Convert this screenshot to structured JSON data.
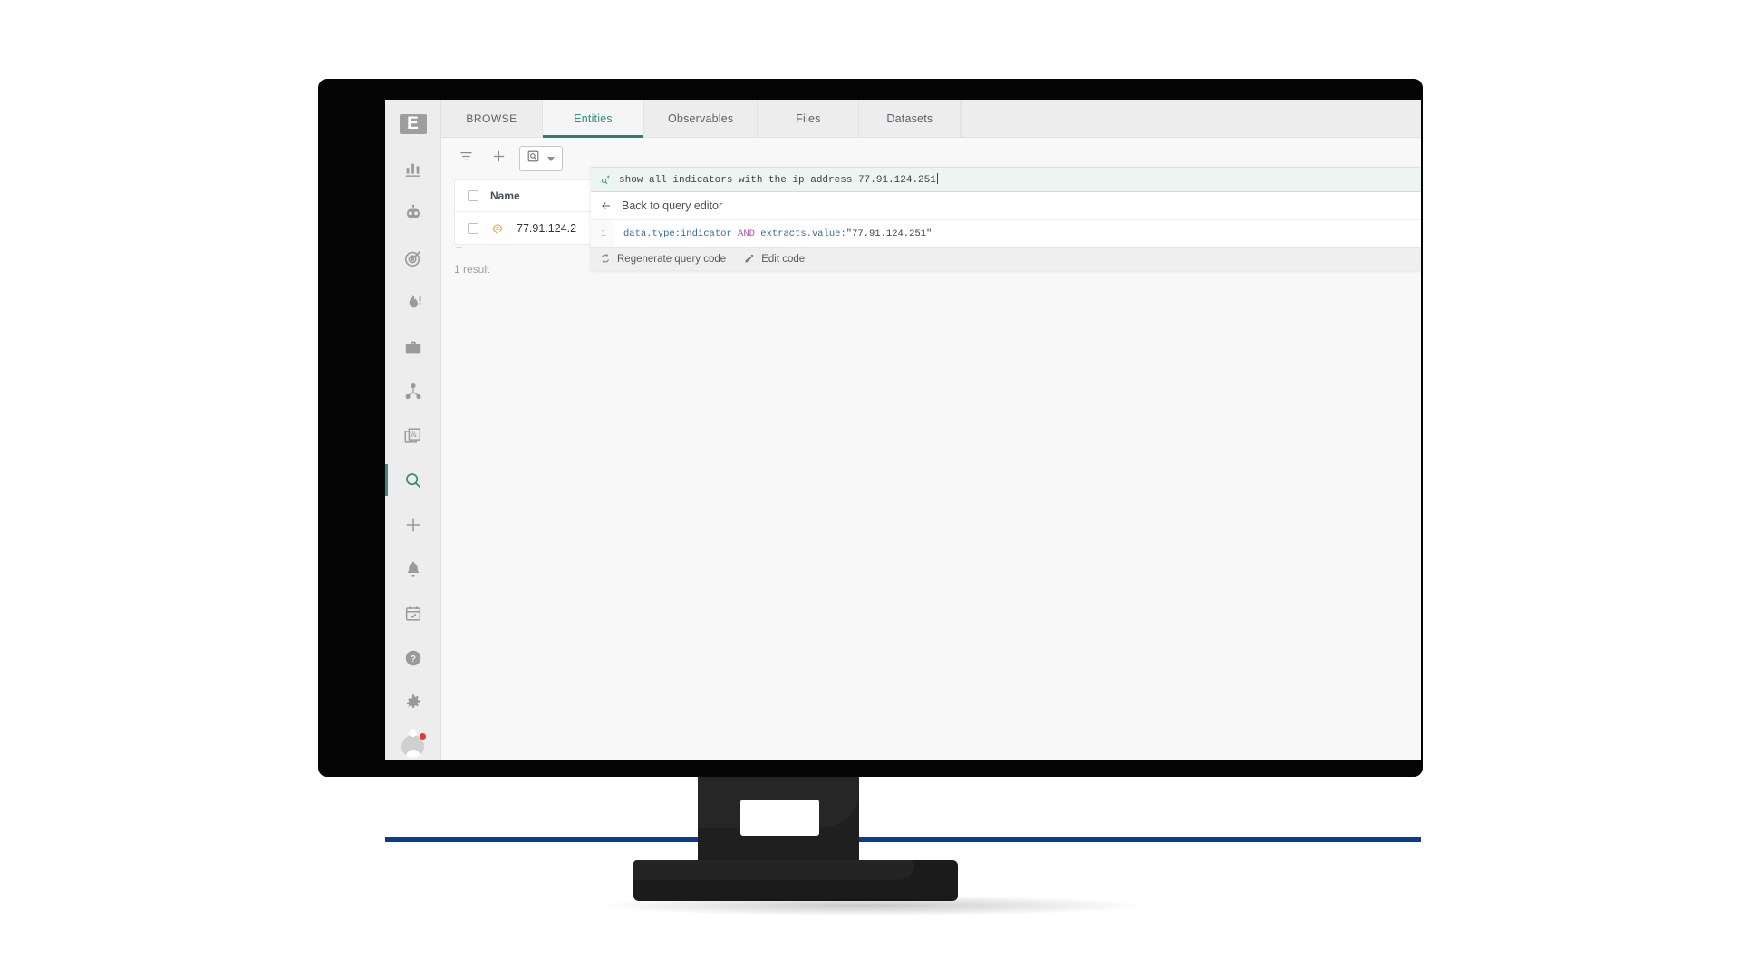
{
  "sidebar": {
    "logo_label": "E",
    "top_items": [
      {
        "name": "dashboard",
        "icon": "bar-chart-icon"
      },
      {
        "name": "automation",
        "icon": "robot-icon"
      },
      {
        "name": "threats",
        "icon": "target-icon"
      },
      {
        "name": "arsenal",
        "icon": "flame-alert-icon"
      },
      {
        "name": "techniques",
        "icon": "briefcase-icon"
      },
      {
        "name": "entities",
        "icon": "network-graph-icon"
      },
      {
        "name": "data",
        "icon": "documents-icon"
      },
      {
        "name": "search",
        "icon": "search-icon",
        "active": true
      },
      {
        "name": "create",
        "icon": "plus-icon"
      }
    ],
    "bottom_items": [
      {
        "name": "notifications",
        "icon": "bell-icon"
      },
      {
        "name": "tasks",
        "icon": "calendar-check-icon"
      },
      {
        "name": "help",
        "icon": "question-circle-icon"
      },
      {
        "name": "settings",
        "icon": "gear-icon"
      },
      {
        "name": "profile",
        "icon": "avatar-icon"
      }
    ]
  },
  "tabs": [
    {
      "label": "BROWSE",
      "active": false,
      "caps": true
    },
    {
      "label": "Entities",
      "active": true,
      "caps": false
    },
    {
      "label": "Observables",
      "active": false,
      "caps": false
    },
    {
      "label": "Files",
      "active": false,
      "caps": false
    },
    {
      "label": "Datasets",
      "active": false,
      "caps": false
    }
  ],
  "toolbar": {
    "filter_icon": "filter-icon",
    "add_icon": "plus-icon",
    "type_select_icon": "box-search-icon"
  },
  "results": {
    "columns": [
      "Name"
    ],
    "rows": [
      {
        "icon": "fingerprint-icon",
        "name": "77.91.124.2"
      }
    ],
    "count_label": "1 result"
  },
  "nl_query": {
    "input_icon": "sparkle-ai-icon",
    "input_text": "show all indicators with the ip address ",
    "input_ip": "77.91.124.251",
    "back_icon": "arrow-left-icon",
    "back_label": "Back to query editor",
    "code_line_number": "1",
    "code_tokens": {
      "field1": "data.type:indicator",
      "operator": "AND",
      "field2": "extracts.value:",
      "string": "\"77.91.124.251\""
    },
    "actions": [
      {
        "label": "Regenerate query code",
        "icon": "refresh-icon"
      },
      {
        "label": "Edit code",
        "icon": "pencil-icon"
      }
    ]
  },
  "colors": {
    "accent": "#3a8a7d",
    "tab_underline": "#2e7d6f",
    "query_bg": "#ecf5f2",
    "row_icon": "#e8a33d",
    "badge": "#e53935",
    "taskbar": "#0c3c8f"
  }
}
